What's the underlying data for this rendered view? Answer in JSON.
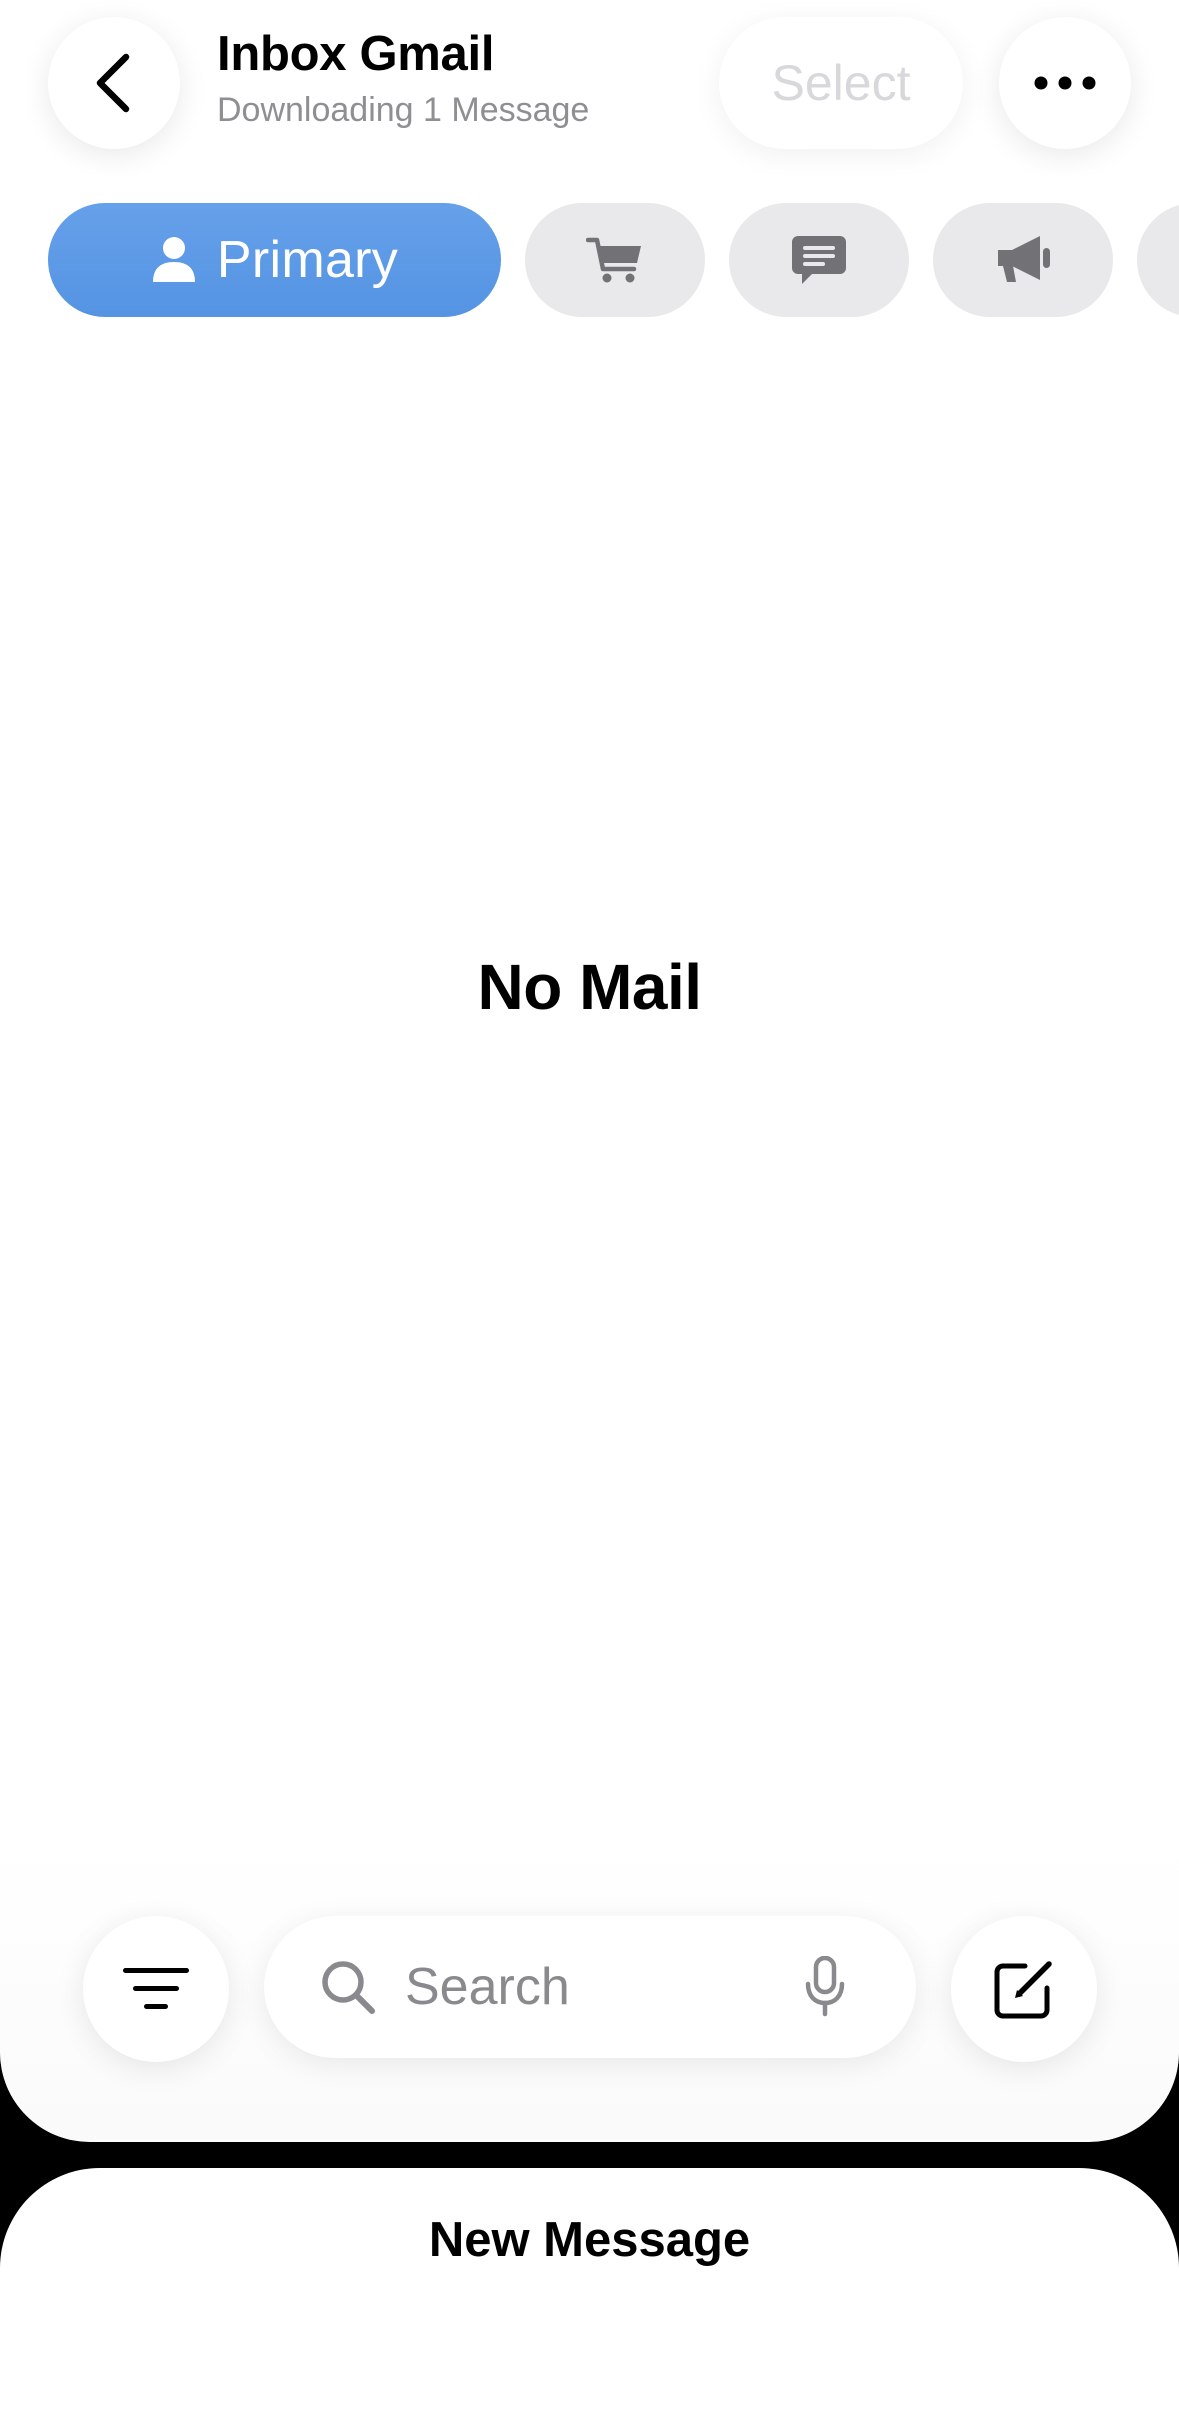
{
  "header": {
    "title": "Inbox Gmail",
    "subtitle": "Downloading 1 Message",
    "select_label": "Select"
  },
  "tabs": [
    {
      "label": "Primary",
      "icon": "person-icon",
      "selected": true
    },
    {
      "icon": "cart-icon",
      "selected": false
    },
    {
      "icon": "chat-bubble-icon",
      "selected": false
    },
    {
      "icon": "megaphone-icon",
      "selected": false
    },
    {
      "icon": "updates-icon",
      "selected": false
    }
  ],
  "main": {
    "empty_state": "No Mail"
  },
  "toolbar": {
    "search_placeholder": "Search"
  },
  "sheet": {
    "title": "New Message"
  },
  "colors": {
    "accent": "#5b9be6",
    "tab_inactive": "#e9e9eb",
    "icon_gray": "#727276",
    "subtitle_gray": "#8e8e93"
  }
}
